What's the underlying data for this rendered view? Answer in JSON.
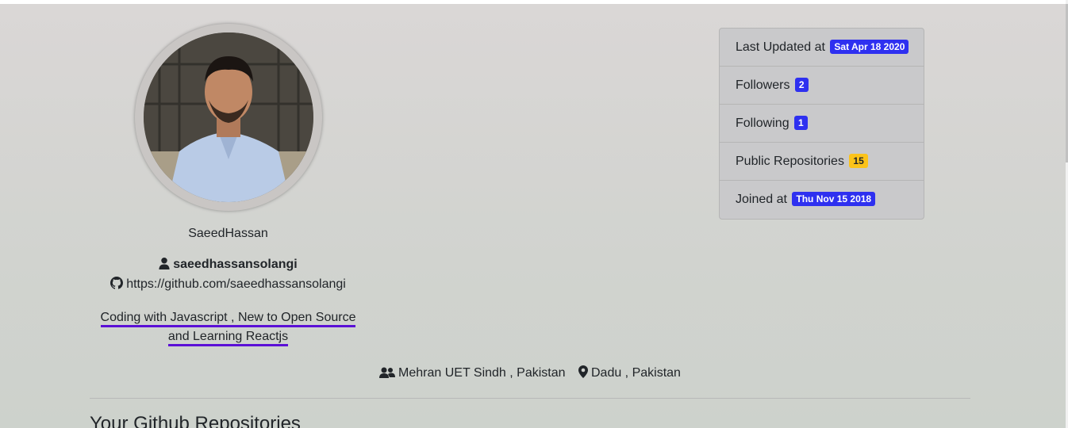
{
  "profile": {
    "name": "SaeedHassan",
    "login": "saeedhassansolangi",
    "github_url": "https://github.com/saeedhassansolangi",
    "bio_line1": "Coding with Javascript , New to Open Source",
    "bio_line2": "and Learning Reactjs",
    "company": "Mehran UET Sindh , Pakistan",
    "location": "Dadu , Pakistan"
  },
  "stats": {
    "last_updated_label": "Last Updated at",
    "last_updated_value": "Sat Apr 18 2020",
    "followers_label": "Followers",
    "followers_value": "2",
    "following_label": "Following",
    "following_value": "1",
    "public_repos_label": "Public Repositories",
    "public_repos_value": "15",
    "joined_label": "Joined at",
    "joined_value": "Thu Nov 15 2018"
  },
  "repos_section": {
    "title": "Your Github Repositories"
  },
  "colors": {
    "badge_primary": "#2e30f0",
    "badge_warning": "#fcc31a",
    "bio_underline": "#5b10d6"
  },
  "icons": {
    "login": "user-icon",
    "github": "github-icon",
    "company": "users-icon",
    "location": "map-marker-icon"
  }
}
